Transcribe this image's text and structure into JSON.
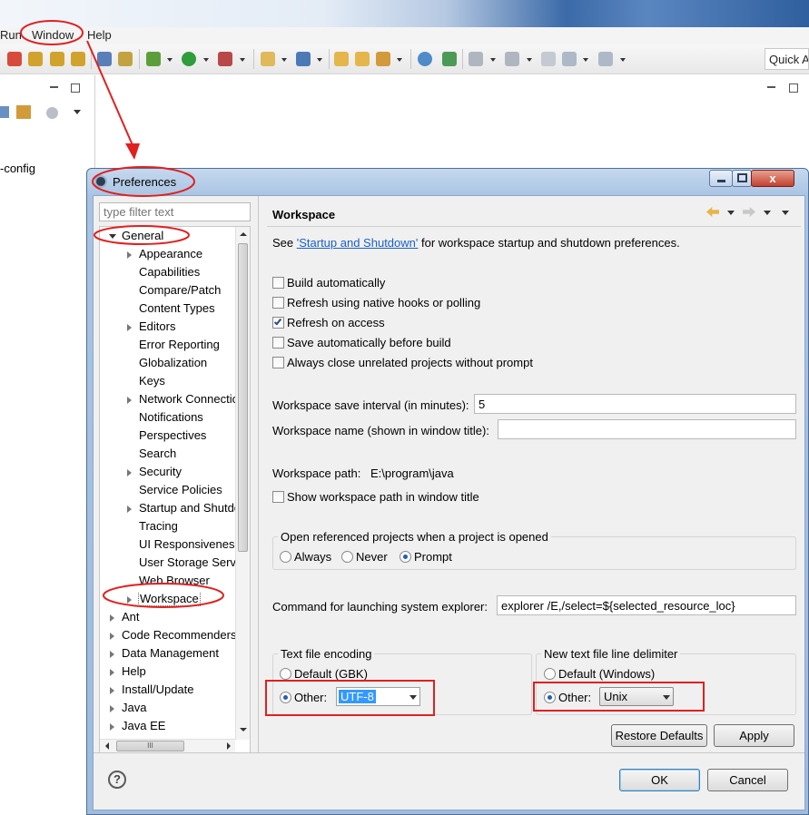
{
  "menubar": {
    "run": "Run",
    "window": "Window",
    "help": "Help"
  },
  "quick_access": "Quick Access",
  "left_view": {
    "config_text": "-config"
  },
  "dialog": {
    "title": "Preferences",
    "filter_placeholder": "type filter text",
    "tree": [
      {
        "label": "General",
        "level": 0,
        "expanded": true
      },
      {
        "label": "Appearance",
        "level": 1,
        "expandable": true
      },
      {
        "label": "Capabilities",
        "level": 1
      },
      {
        "label": "Compare/Patch",
        "level": 1
      },
      {
        "label": "Content Types",
        "level": 1
      },
      {
        "label": "Editors",
        "level": 1,
        "expandable": true
      },
      {
        "label": "Error Reporting",
        "level": 1
      },
      {
        "label": "Globalization",
        "level": 1
      },
      {
        "label": "Keys",
        "level": 1
      },
      {
        "label": "Network Connections",
        "level": 1,
        "expandable": true
      },
      {
        "label": "Notifications",
        "level": 1
      },
      {
        "label": "Perspectives",
        "level": 1
      },
      {
        "label": "Search",
        "level": 1
      },
      {
        "label": "Security",
        "level": 1,
        "expandable": true
      },
      {
        "label": "Service Policies",
        "level": 1
      },
      {
        "label": "Startup and Shutdown",
        "level": 1,
        "expandable": true
      },
      {
        "label": "Tracing",
        "level": 1
      },
      {
        "label": "UI Responsiveness",
        "level": 1
      },
      {
        "label": "User Storage Service",
        "level": 1
      },
      {
        "label": "Web Browser",
        "level": 1
      },
      {
        "label": "Workspace",
        "level": 1,
        "expandable": true,
        "selected": true
      },
      {
        "label": "Ant",
        "level": 0,
        "expandable": true
      },
      {
        "label": "Code Recommenders",
        "level": 0,
        "expandable": true
      },
      {
        "label": "Data Management",
        "level": 0,
        "expandable": true
      },
      {
        "label": "Help",
        "level": 0,
        "expandable": true
      },
      {
        "label": "Install/Update",
        "level": 0,
        "expandable": true
      },
      {
        "label": "Java",
        "level": 0,
        "expandable": true
      },
      {
        "label": "Java EE",
        "level": 0,
        "expandable": true
      }
    ],
    "hscroll_grip": "III",
    "page_title": "Workspace",
    "see_prefix": "See ",
    "see_link": "'Startup and Shutdown'",
    "see_suffix": " for workspace startup and shutdown preferences.",
    "checkboxes": [
      {
        "label": "Build automatically",
        "checked": false
      },
      {
        "label": "Refresh using native hooks or polling",
        "checked": false
      },
      {
        "label": "Refresh on access",
        "checked": true
      },
      {
        "label": "Save automatically before build",
        "checked": false
      },
      {
        "label": "Always close unrelated projects without prompt",
        "checked": false
      }
    ],
    "save_interval_label": "Workspace save interval (in minutes):",
    "save_interval_value": "5",
    "workspace_name_label": "Workspace name (shown in window title):",
    "workspace_name_value": "",
    "workspace_path_label": "Workspace path:",
    "workspace_path_value": "E:\\program\\java",
    "show_path_label": "Show workspace path in window title",
    "open_ref_title": "Open referenced projects when a project is opened",
    "open_ref_options": [
      {
        "label": "Always",
        "selected": false
      },
      {
        "label": "Never",
        "selected": false
      },
      {
        "label": "Prompt",
        "selected": true
      }
    ],
    "explorer_label": "Command for launching system explorer:",
    "explorer_value": "explorer /E,/select=${selected_resource_loc}",
    "encoding": {
      "title": "Text file encoding",
      "default_label": "Default (GBK)",
      "other_label": "Other:",
      "other_selected": true,
      "value": "UTF-8"
    },
    "delimiter": {
      "title": "New text file line delimiter",
      "default_label": "Default (Windows)",
      "other_label": "Other:",
      "other_selected": true,
      "value": "Unix"
    },
    "restore_defaults": "Restore Defaults",
    "apply": "Apply",
    "help_icon_text": "?",
    "ok": "OK",
    "cancel": "Cancel",
    "close_glyph": "x"
  },
  "annotation_color": "#e02020"
}
